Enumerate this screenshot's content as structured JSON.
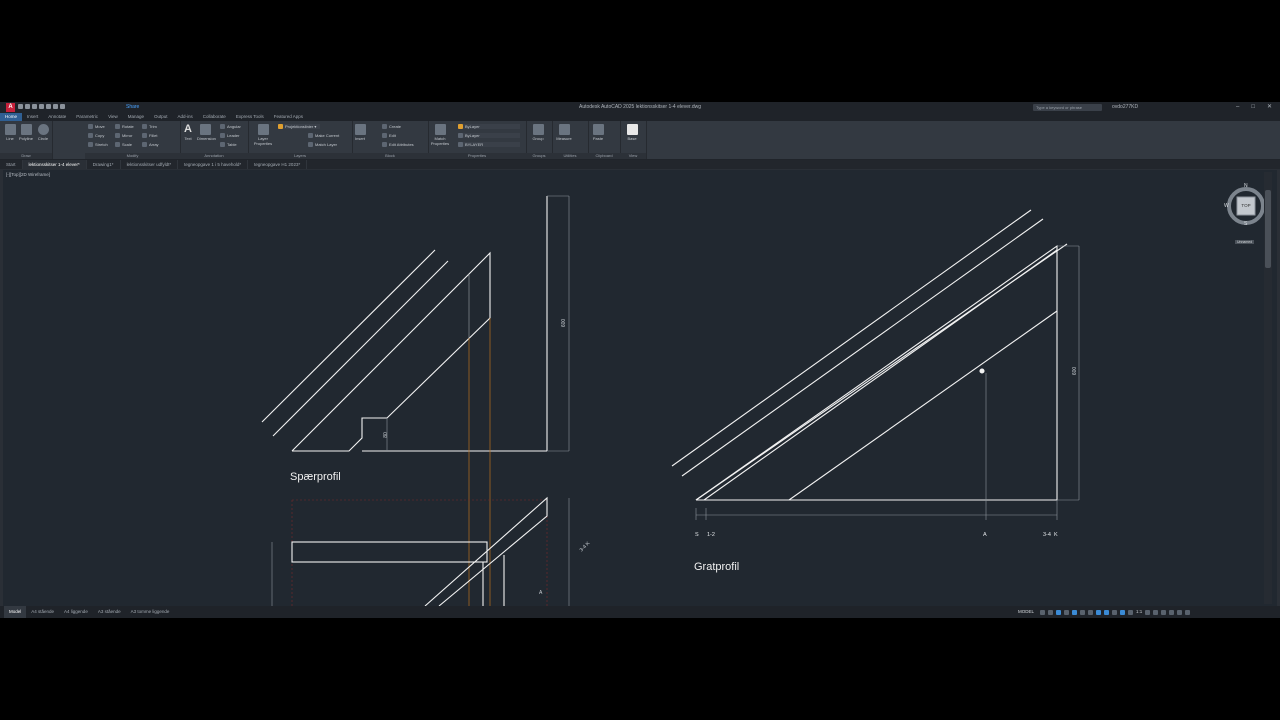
{
  "app": {
    "title": "Autodesk AutoCAD 2025    lektionsskitser 1-4 elever.dwg",
    "share": "Share",
    "search_placeholder": "Type a keyword or phrase",
    "user": "ovdo277KD"
  },
  "ribbon_tabs": [
    "Home",
    "Insert",
    "Annotate",
    "Parametric",
    "View",
    "Manage",
    "Output",
    "Add-ins",
    "Collaborate",
    "Express Tools",
    "Featured Apps"
  ],
  "ribbon": {
    "draw": {
      "label": "Draw",
      "line": "Line",
      "polyline": "Polyline",
      "circle": "Circle",
      "arc": "Arc"
    },
    "modify": {
      "label": "Modify",
      "move": "Move",
      "rotate": "Rotate",
      "trim": "Trim",
      "copy": "Copy",
      "mirror": "Mirror",
      "fillet": "Fillet",
      "stretch": "Stretch",
      "scale": "Scale",
      "array": "Array"
    },
    "annotation": {
      "label": "Annotation",
      "text": "Text",
      "dimension": "Dimension",
      "linear": "Angular",
      "leader": "Leader",
      "table": "Table"
    },
    "layers": {
      "label": "Layers",
      "layer_properties": "Layer Properties",
      "current_layer": "Projektionslinier",
      "make_current": "Make Current",
      "match_layer": "Match Layer"
    },
    "block": {
      "label": "Block",
      "insert": "Insert",
      "create": "Create",
      "edit": "Edit",
      "edit_attributes": "Edit Attributes"
    },
    "properties": {
      "label": "Properties",
      "match": "Match Properties",
      "bylayer1": "ByLayer",
      "bylayer2": "ByLayer",
      "bylayer3": "BYLAYER"
    },
    "groups": {
      "label": "Groups",
      "group": "Group"
    },
    "utilities": {
      "label": "Utilities",
      "measure": "Measure"
    },
    "clipboard": {
      "label": "Clipboard",
      "paste": "Paste"
    },
    "view": {
      "label": "View",
      "base": "Base"
    }
  },
  "doc_tabs": [
    "Start",
    "lektionsskitser 1-4 elever*",
    "Drawing1*",
    "lektionsskitser udfyldt*",
    "tegneopgave 1 i 5 havehold*",
    "tegneopgave H1 2023*"
  ],
  "viewport_label": "[-][Top][2D Wireframe]",
  "viewcube": {
    "top": "TOP",
    "n": "N",
    "s": "S",
    "e": "E",
    "w": "W",
    "wcs": "Unnamed"
  },
  "drawing": {
    "label_sparprofil": "Spærprofil",
    "label_gratprofil": "Gratprofil",
    "dim_600_left": "600",
    "dim_80": "80",
    "dim_600_right": "600",
    "dim_34k_left": "3-4 K",
    "axis_s": "S",
    "axis_12": "1-2",
    "axis_a": "A",
    "axis_34k": "3-4  K",
    "mark_a_small": "A"
  },
  "layout_tabs": [
    "Model",
    "A4 stående",
    "A4 liggende",
    "A3 stående",
    "A3 tomme liggende"
  ],
  "status": {
    "model": "MODEL",
    "zoom": "1:1"
  }
}
